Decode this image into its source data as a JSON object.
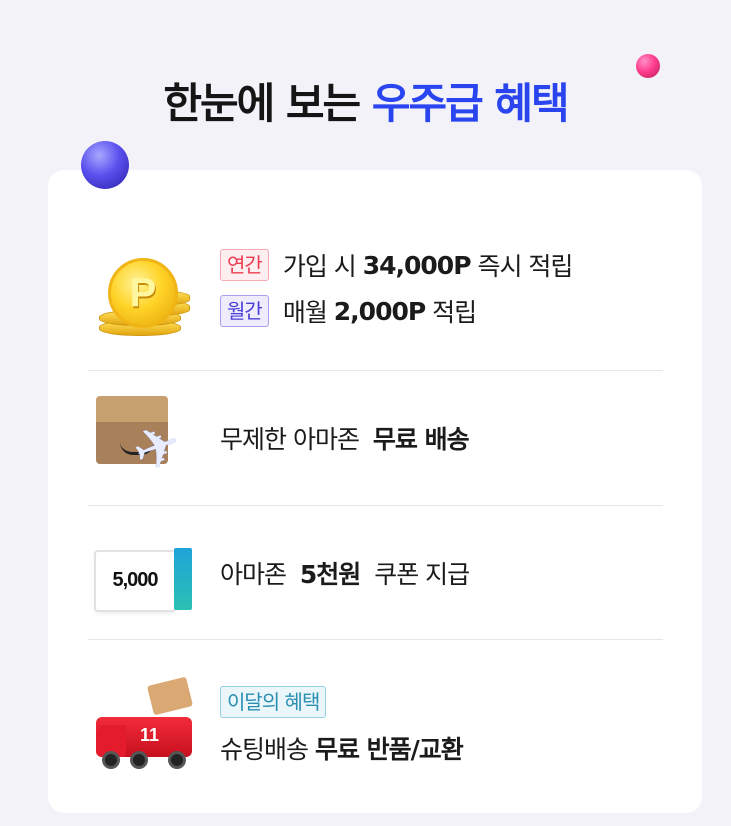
{
  "title": {
    "main": "한눈에 보는",
    "accent": "우주급 혜택"
  },
  "colors": {
    "accent": "#2a45ef",
    "tag_red": "#ef3b52",
    "tag_purple": "#4b3ed6",
    "tag_teal": "#2a8fb2"
  },
  "benefits": [
    {
      "icon": "gold-coins-icon",
      "coin_mark": "P",
      "lines": [
        {
          "tag": "연간",
          "pre": "가입 시 ",
          "bold": "34,000P",
          "post": " 즉시 적립"
        },
        {
          "tag": "월간",
          "pre": "매월 ",
          "bold": "2,000P",
          "post": " 적립"
        }
      ]
    },
    {
      "icon": "amazon-box-plane-icon",
      "text_pre": "무제한 아마존 ",
      "text_bold": "무료 배송"
    },
    {
      "icon": "coupon-icon",
      "coupon_value": "5,000",
      "text_pre": "아마존 ",
      "text_bold": "5천원",
      "text_post": " 쿠폰 지급"
    },
    {
      "icon": "delivery-truck-icon",
      "truck_mark": "11",
      "tag": "이달의 혜택",
      "text_pre": "슈팅배송 ",
      "text_bold": "무료 반품/교환"
    }
  ]
}
